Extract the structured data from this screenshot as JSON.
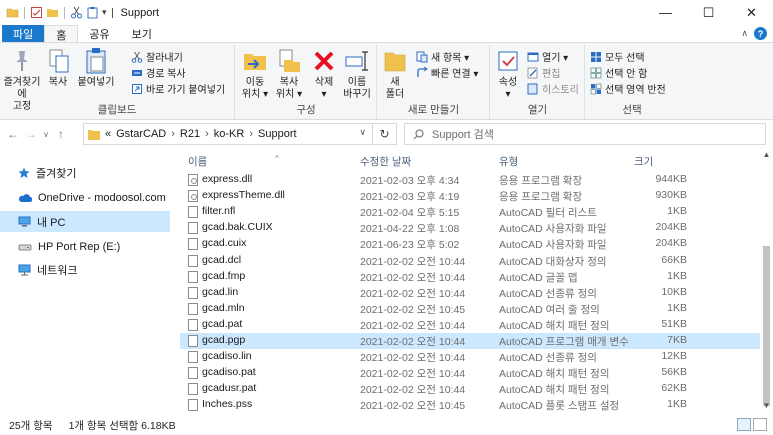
{
  "window": {
    "title": "Support",
    "min_glyph": "—",
    "max_glyph": "☐",
    "close_glyph": "✕"
  },
  "tabs": [
    "파일",
    "홈",
    "공유",
    "보기"
  ],
  "ribbon": {
    "clipboard": {
      "pin_label_1": "즐겨찾기에",
      "pin_label_2": "고정",
      "copy_label": "복사",
      "paste_label": "붙여넣기",
      "cut_label": "잘라내기",
      "copy_path_label": "경로 복사",
      "paste_shortcut_label": "바로 가기 붙여넣기",
      "group_label": "클립보드"
    },
    "organize": {
      "move_label_1": "이동",
      "move_label_2": "위치 ▾",
      "copyto_label_1": "복사",
      "copyto_label_2": "위치 ▾",
      "delete_label_1": "삭제",
      "delete_label_2": "▾",
      "rename_label_1": "이름",
      "rename_label_2": "바꾸기",
      "group_label": "구성"
    },
    "new": {
      "new_folder_label_1": "새",
      "new_folder_label_2": "폴더",
      "new_item_label": "새 항목 ▾",
      "easy_access_label": "빠른 연결 ▾",
      "group_label": "새로 만들기"
    },
    "open": {
      "properties_label_1": "속성",
      "properties_label_2": "▾",
      "open_label": "열기 ▾",
      "edit_label": "편집",
      "history_label": "히스토리",
      "group_label": "열기"
    },
    "select": {
      "select_all_label": "모두 선택",
      "select_none_label": "선택 안 함",
      "invert_label": "선택 영역 반전",
      "group_label": "선택"
    }
  },
  "address": {
    "prefix": "«",
    "path": [
      "GstarCAD",
      "R21",
      "ko-KR",
      "Support"
    ],
    "search_placeholder": "Support 검색"
  },
  "nav_pane": [
    {
      "label": "즐겨찾기",
      "icon": "star-icon",
      "selected": false
    },
    {
      "label": "OneDrive - modoosol.com",
      "icon": "cloud-icon",
      "selected": false
    },
    {
      "label": "내 PC",
      "icon": "computer-icon",
      "selected": true
    },
    {
      "label": "HP Port Rep (E:)",
      "icon": "drive-icon",
      "selected": false
    },
    {
      "label": "네트워크",
      "icon": "network-icon",
      "selected": false
    }
  ],
  "columns": {
    "name": "이름",
    "date": "수정한 날짜",
    "type": "유형",
    "size": "크기"
  },
  "files": [
    {
      "name": "express.dll",
      "date": "2021-02-03 오후 4:34",
      "type": "응용 프로그램 확장",
      "size": "944KB",
      "kind": "dll"
    },
    {
      "name": "expressTheme.dll",
      "date": "2021-02-03 오후 4:19",
      "type": "응용 프로그램 확장",
      "size": "930KB",
      "kind": "dll"
    },
    {
      "name": "filter.nfl",
      "date": "2021-02-04 오후 5:15",
      "type": "AutoCAD 필터 리스트",
      "size": "1KB",
      "kind": "file"
    },
    {
      "name": "gcad.bak.CUIX",
      "date": "2021-04-22 오후 1:08",
      "type": "AutoCAD 사용자화 파일",
      "size": "204KB",
      "kind": "file"
    },
    {
      "name": "gcad.cuix",
      "date": "2021-06-23 오후 5:02",
      "type": "AutoCAD 사용자화 파일",
      "size": "204KB",
      "kind": "file"
    },
    {
      "name": "gcad.dcl",
      "date": "2021-02-02 오전 10:44",
      "type": "AutoCAD 대화상자 정의",
      "size": "66KB",
      "kind": "file"
    },
    {
      "name": "gcad.fmp",
      "date": "2021-02-02 오전 10:44",
      "type": "AutoCAD 글꼴 맵",
      "size": "1KB",
      "kind": "file"
    },
    {
      "name": "gcad.lin",
      "date": "2021-02-02 오전 10:44",
      "type": "AutoCAD 선종류 정의",
      "size": "10KB",
      "kind": "file"
    },
    {
      "name": "gcad.mln",
      "date": "2021-02-02 오전 10:45",
      "type": "AutoCAD 여러 줄 정의",
      "size": "1KB",
      "kind": "file"
    },
    {
      "name": "gcad.pat",
      "date": "2021-02-02 오전 10:44",
      "type": "AutoCAD 해치 패턴 정의",
      "size": "51KB",
      "kind": "file"
    },
    {
      "name": "gcad.pgp",
      "date": "2021-02-02 오전 10:44",
      "type": "AutoCAD 프로그램 매개 변수",
      "size": "7KB",
      "kind": "file",
      "selected": true
    },
    {
      "name": "gcadiso.lin",
      "date": "2021-02-02 오전 10:44",
      "type": "AutoCAD 선종류 정의",
      "size": "12KB",
      "kind": "file"
    },
    {
      "name": "gcadiso.pat",
      "date": "2021-02-02 오전 10:44",
      "type": "AutoCAD 해치 패턴 정의",
      "size": "56KB",
      "kind": "file"
    },
    {
      "name": "gcadusr.pat",
      "date": "2021-02-02 오전 10:44",
      "type": "AutoCAD 해치 패턴 정의",
      "size": "62KB",
      "kind": "file"
    },
    {
      "name": "Inches.pss",
      "date": "2021-02-02 오전 10:45",
      "type": "AutoCAD 플롯 스탬프 설정",
      "size": "1KB",
      "kind": "file"
    }
  ],
  "status": {
    "count": "25개 항목",
    "selection": "1개 항목 선택함 6.18KB"
  },
  "colors": {
    "accent": "#1979ca",
    "selection": "#cce8ff",
    "folder": "#f0c24b",
    "delete_red": "#e81123"
  }
}
